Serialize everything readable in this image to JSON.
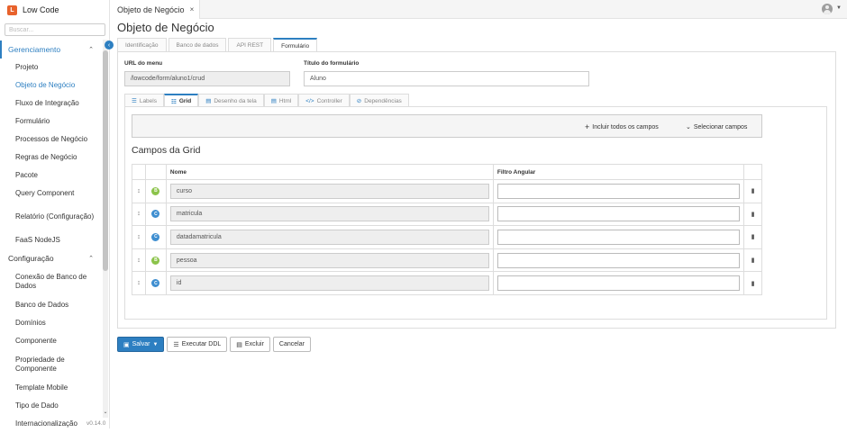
{
  "brand": {
    "logo_letter": "L",
    "name": "Low Code"
  },
  "search": {
    "placeholder": "Buscar..."
  },
  "sidebar": {
    "groups": [
      {
        "label": "Gerenciamento",
        "expanded": true,
        "items": [
          {
            "label": "Projeto"
          },
          {
            "label": "Objeto de Negócio",
            "selected": true
          },
          {
            "label": "Fluxo de Integração"
          },
          {
            "label": "Formulário"
          },
          {
            "label": "Processos de Negócio"
          },
          {
            "label": "Regras de Negócio"
          },
          {
            "label": "Pacote"
          },
          {
            "label": "Query Component"
          },
          {
            "label": "Relatório (Configuração)"
          },
          {
            "label": "FaaS NodeJS"
          }
        ]
      },
      {
        "label": "Configuração",
        "expanded": true,
        "items": [
          {
            "label": "Conexão de Banco de Dados"
          },
          {
            "label": "Banco de Dados"
          },
          {
            "label": "Domínios"
          },
          {
            "label": "Componente"
          },
          {
            "label": "Propriedade de Componente"
          },
          {
            "label": "Template Mobile"
          },
          {
            "label": "Tipo de Dado"
          },
          {
            "label": "Internacionalização"
          }
        ]
      }
    ],
    "version": "v0.14.0"
  },
  "topbar": {
    "open_tab": "Objeto de Negócio"
  },
  "page": {
    "title": "Objeto de Negócio"
  },
  "tabs": [
    "Identificação",
    "Banco de dados",
    "API REST",
    "Formulário"
  ],
  "active_tab": "Formulário",
  "form": {
    "url_label": "URL do menu",
    "url_value": "/lowcode/form/aluno1/crud",
    "title_label": "Título do formulário",
    "title_value": "Aluno"
  },
  "subtabs": [
    {
      "icon": "list-icon",
      "label": "Labels"
    },
    {
      "icon": "grid-icon",
      "label": "Grid"
    },
    {
      "icon": "file-icon",
      "label": "Desenho da tela"
    },
    {
      "icon": "file-icon",
      "label": "Html"
    },
    {
      "icon": "code-icon",
      "label": "Controller"
    },
    {
      "icon": "link-icon",
      "label": "Dependências"
    }
  ],
  "active_subtab": "Grid",
  "toolbar": {
    "include_all": "Incluir todos os campos",
    "select_fields": "Selecionar campos"
  },
  "grid": {
    "title": "Campos da Grid",
    "columns": [
      "Nome",
      "Filtro Angular"
    ],
    "rows": [
      {
        "badge": "B",
        "badge_color": "#8bc34a",
        "name": "curso",
        "filter": ""
      },
      {
        "badge": "C",
        "badge_color": "#3e8ed0",
        "name": "matricula",
        "filter": ""
      },
      {
        "badge": "C",
        "badge_color": "#3e8ed0",
        "name": "datadamatricula",
        "filter": ""
      },
      {
        "badge": "B",
        "badge_color": "#8bc34a",
        "name": "pessoa",
        "filter": ""
      },
      {
        "badge": "C",
        "badge_color": "#3e8ed0",
        "name": "id",
        "filter": ""
      }
    ]
  },
  "footer": {
    "save": "Salvar",
    "execute": "Executar DDL",
    "delete": "Excluir",
    "cancel": "Cancelar"
  },
  "colors": {
    "accent": "#2d7fc1",
    "brand": "#e8622c"
  }
}
